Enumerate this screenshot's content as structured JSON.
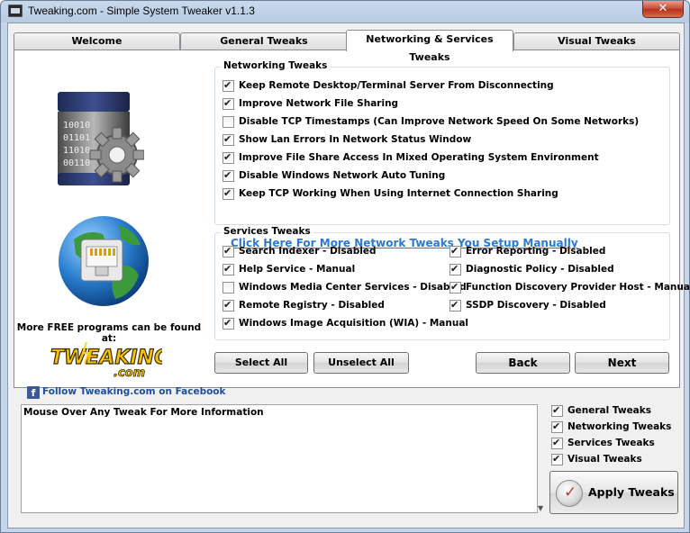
{
  "window": {
    "title": "Tweaking.com - Simple System Tweaker v1.1.3",
    "close_glyph": "✕"
  },
  "tabs": [
    {
      "label": "Welcome",
      "active": false
    },
    {
      "label": "General Tweaks",
      "active": false
    },
    {
      "label": "Networking & Services Tweaks",
      "active": true
    },
    {
      "label": "Visual Tweaks",
      "active": false
    }
  ],
  "left_panel": {
    "free_text": "More FREE programs can be found at:",
    "logo_text": "TWEAKING",
    "logo_sub": ".com",
    "facebook_icon_glyph": "f",
    "facebook_link": "Follow Tweaking.com on Facebook"
  },
  "networking": {
    "title": "Networking Tweaks",
    "items": [
      {
        "label": "Keep Remote Desktop/Terminal Server From Disconnecting",
        "checked": true
      },
      {
        "label": "Improve Network File Sharing",
        "checked": true
      },
      {
        "label": "Disable TCP Timestamps (Can Improve Network Speed On Some Networks)",
        "checked": false
      },
      {
        "label": "Show Lan Errors In Network Status Window",
        "checked": true
      },
      {
        "label": "Improve File Share Access In Mixed Operating System Environment",
        "checked": true
      },
      {
        "label": "Disable Windows Network Auto Tuning",
        "checked": true
      },
      {
        "label": "Keep TCP Working When Using Internet Connection Sharing",
        "checked": true
      }
    ],
    "manual_link": "Click Here For More Network Tweaks You Setup Manually"
  },
  "services": {
    "title": "Services Tweaks",
    "left": [
      {
        "label": "Search Indexer - Disabled",
        "checked": true
      },
      {
        "label": "Help Service - Manual",
        "checked": true
      },
      {
        "label": "Windows Media Center Services - Disabled",
        "checked": false
      },
      {
        "label": "Remote Registry - Disabled",
        "checked": true
      },
      {
        "label": "Windows Image Acquisition (WIA) - Manual",
        "checked": true
      }
    ],
    "right": [
      {
        "label": "Error Reporting - Disabled",
        "checked": true
      },
      {
        "label": "Diagnostic Policy - Disabled",
        "checked": true
      },
      {
        "label": "Function Discovery Provider Host - Manual",
        "checked": true
      },
      {
        "label": "SSDP Discovery - Disabled",
        "checked": true
      }
    ]
  },
  "buttons": {
    "select_all": "Select All",
    "unselect_all": "Unselect All",
    "back": "Back",
    "next": "Next"
  },
  "info": {
    "text": "Mouse Over Any Tweak For More Information",
    "scroll_glyph": "▼"
  },
  "apply_options": [
    {
      "label": "General Tweaks",
      "checked": true
    },
    {
      "label": "Networking Tweaks",
      "checked": true
    },
    {
      "label": "Services Tweaks",
      "checked": true
    },
    {
      "label": "Visual Tweaks",
      "checked": true
    }
  ],
  "apply_button": {
    "label": "Apply Tweaks"
  },
  "icons": [
    "app-icon",
    "close-icon",
    "server-gear-icon",
    "network-globe-icon",
    "facebook-icon",
    "apply-icon"
  ]
}
